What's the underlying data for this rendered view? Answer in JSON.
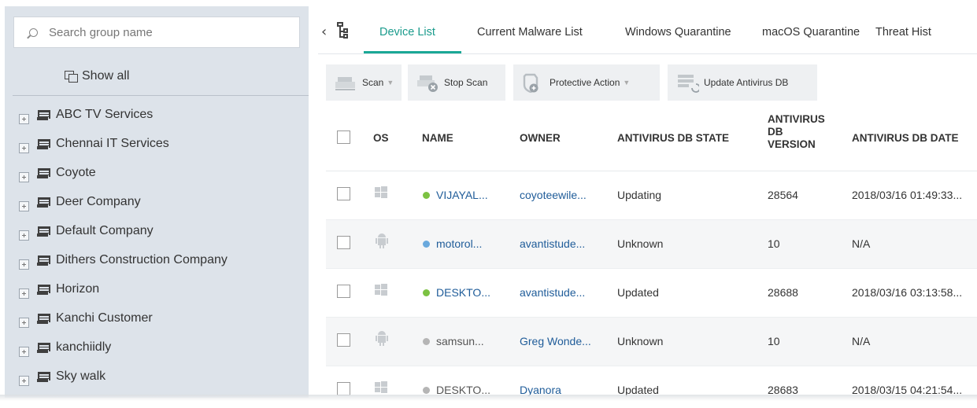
{
  "sidebar": {
    "search_placeholder": "Search group name",
    "show_all_label": "Show all",
    "groups": [
      "ABC TV Services",
      "Chennai IT Services",
      "Coyote",
      "Deer Company",
      "Default Company",
      "Dithers Construction Company",
      "Horizon",
      "Kanchi Customer",
      "kanchiidly",
      "Sky walk"
    ]
  },
  "tabs": [
    "Device List",
    "Current Malware List",
    "Windows Quarantine",
    "macOS Quarantine",
    "Threat Hist"
  ],
  "active_tab": "Device List",
  "toolbar": {
    "scan": "Scan",
    "stop_scan": "Stop Scan",
    "protective_action": "Protective Action",
    "update_db": "Update Antivirus DB"
  },
  "table": {
    "headers": {
      "os": "OS",
      "name": "NAME",
      "owner": "OWNER",
      "state": "ANTIVIRUS DB STATE",
      "version_l1": "ANTIVIRUS",
      "version_l2": "DB",
      "version_l3": "VERSION",
      "date": "ANTIVIRUS DB DATE"
    },
    "rows": [
      {
        "os": "windows",
        "status_color": "#7cc242",
        "name": "VIJAYAL...",
        "owner": "coyoteewile...",
        "state": "Updating",
        "version": "28564",
        "date": "2018/03/16 01:49:33..."
      },
      {
        "os": "android",
        "status_color": "#6aa9dd",
        "name": "motorol...",
        "owner": "avantistude...",
        "state": "Unknown",
        "version": "10",
        "date": "N/A"
      },
      {
        "os": "windows",
        "status_color": "#7cc242",
        "name": "DESKTO...",
        "owner": "avantistude...",
        "state": "Updated",
        "version": "28688",
        "date": "2018/03/16 03:13:58..."
      },
      {
        "os": "android",
        "status_color": "#b5b5b5",
        "name": "samsun...",
        "owner": "Greg Wonde...",
        "state": "Unknown",
        "version": "10",
        "date": "N/A"
      },
      {
        "os": "windows",
        "status_color": "#b5b5b5",
        "name": "DESKTO...",
        "owner": "Dyanora",
        "state": "Updated",
        "version": "28683",
        "date": "2018/03/15 04:21:54..."
      }
    ]
  },
  "colors": {
    "accent": "#1aa896",
    "link": "#1f5c99",
    "sidebar_bg": "#dde3ea",
    "online": "#7cc242",
    "offline": "#b5b5b5",
    "android_status": "#6aa9dd"
  }
}
